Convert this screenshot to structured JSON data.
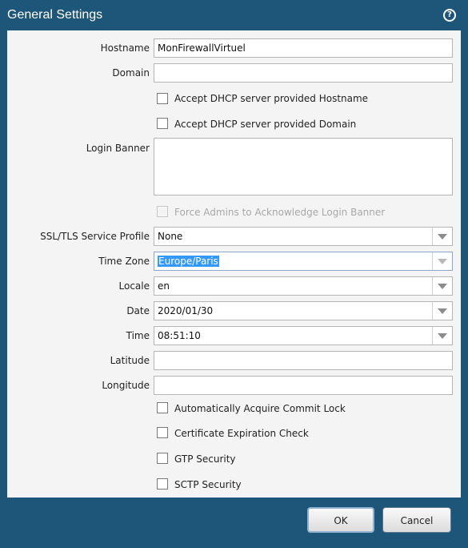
{
  "dialog": {
    "title": "General Settings",
    "help_label": "?"
  },
  "fields": {
    "hostname": {
      "label": "Hostname",
      "value": "MonFirewallVirtuel"
    },
    "domain": {
      "label": "Domain",
      "value": ""
    },
    "dhcp_hostname": {
      "label": "Accept DHCP server provided Hostname",
      "checked": false
    },
    "dhcp_domain": {
      "label": "Accept DHCP server provided Domain",
      "checked": false
    },
    "login_banner": {
      "label": "Login Banner",
      "value": ""
    },
    "force_ack": {
      "label": "Force Admins to Acknowledge Login Banner",
      "checked": false,
      "disabled": true
    },
    "ssl_profile": {
      "label": "SSL/TLS Service Profile",
      "value": "None"
    },
    "time_zone": {
      "label": "Time Zone",
      "value": "Europe/Paris"
    },
    "locale": {
      "label": "Locale",
      "value": "en"
    },
    "date": {
      "label": "Date",
      "value": "2020/01/30"
    },
    "time": {
      "label": "Time",
      "value": "08:51:10"
    },
    "latitude": {
      "label": "Latitude",
      "value": ""
    },
    "longitude": {
      "label": "Longitude",
      "value": ""
    },
    "commit_lock": {
      "label": "Automatically Acquire Commit Lock",
      "checked": false
    },
    "cert_check": {
      "label": "Certificate Expiration Check",
      "checked": false
    },
    "gtp": {
      "label": "GTP Security",
      "checked": false
    },
    "sctp": {
      "label": "SCTP Security",
      "checked": false
    }
  },
  "buttons": {
    "ok": "OK",
    "cancel": "Cancel"
  },
  "colors": {
    "header": "#1e5679",
    "body": "#f4f4f4",
    "selection": "#3399ff"
  }
}
